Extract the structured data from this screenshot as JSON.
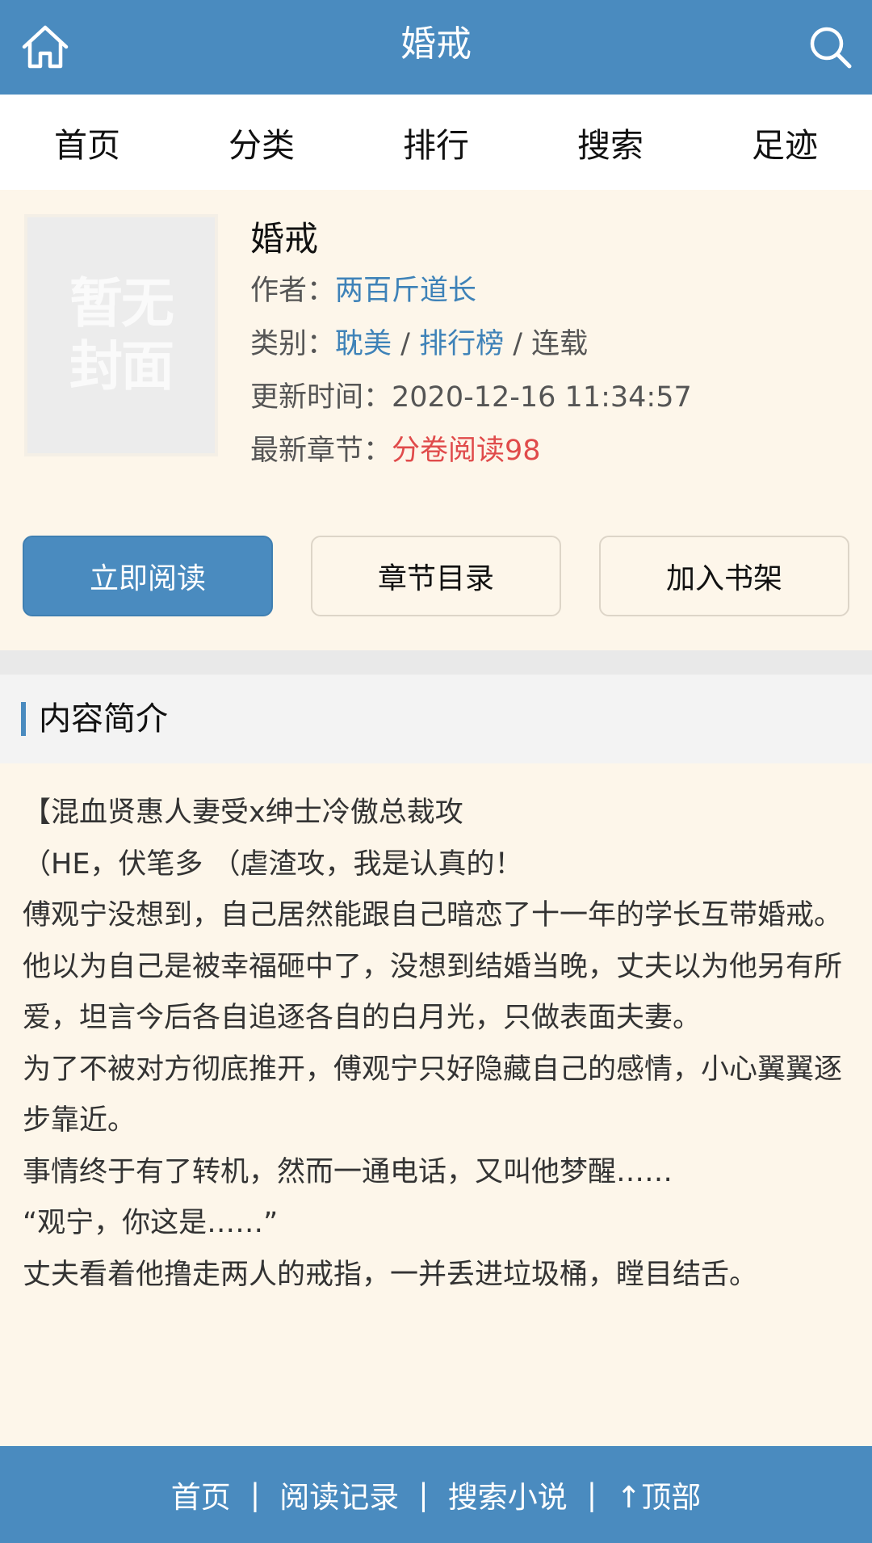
{
  "header": {
    "title": "婚戒",
    "home_icon": "home-icon",
    "search_icon": "search-icon"
  },
  "nav": {
    "items": [
      "首页",
      "分类",
      "排行",
      "搜索",
      "足迹"
    ]
  },
  "book": {
    "cover_text": "暂无封面",
    "title": "婚戒",
    "author_label": "作者：",
    "author": "两百斤道长",
    "category_label": "类别：",
    "category": "耽美",
    "ranking": "排行榜",
    "status": "连载",
    "update_label": "更新时间：",
    "update_time": "2020-12-16 11:34:57",
    "latest_label": "最新章节：",
    "latest_chapter": "分卷阅读98"
  },
  "actions": {
    "read": "立即阅读",
    "toc": "章节目录",
    "shelf": "加入书架"
  },
  "intro": {
    "heading": "内容简介",
    "lines": [
      "【混血贤惠人妻受x绅士冷傲总裁攻",
      "（HE，伏笔多 （虐渣攻，我是认真的！",
      "傅观宁没想到，自己居然能跟自己暗恋了十一年的学长互带婚戒。",
      "他以为自己是被幸福砸中了，没想到结婚当晚，丈夫以为他另有所爱，坦言今后各自追逐各自的白月光，只做表面夫妻。",
      "为了不被对方彻底推开，傅观宁只好隐藏自己的感情，小心翼翼逐步靠近。",
      "事情终于有了转机，然而一通电话，又叫他梦醒……",
      "“观宁，你这是……”",
      "丈夫看着他撸走两人的戒指，一并丢进垃圾桶，瞠目结舌。"
    ]
  },
  "footer": {
    "home": "首页",
    "history": "阅读记录",
    "search": "搜索小说",
    "top": "↑顶部",
    "sep": "|"
  },
  "colors": {
    "brand": "#4a8bbf",
    "link": "#3e82b8",
    "highlight": "#e04b4b",
    "background": "#fdf6ea"
  }
}
